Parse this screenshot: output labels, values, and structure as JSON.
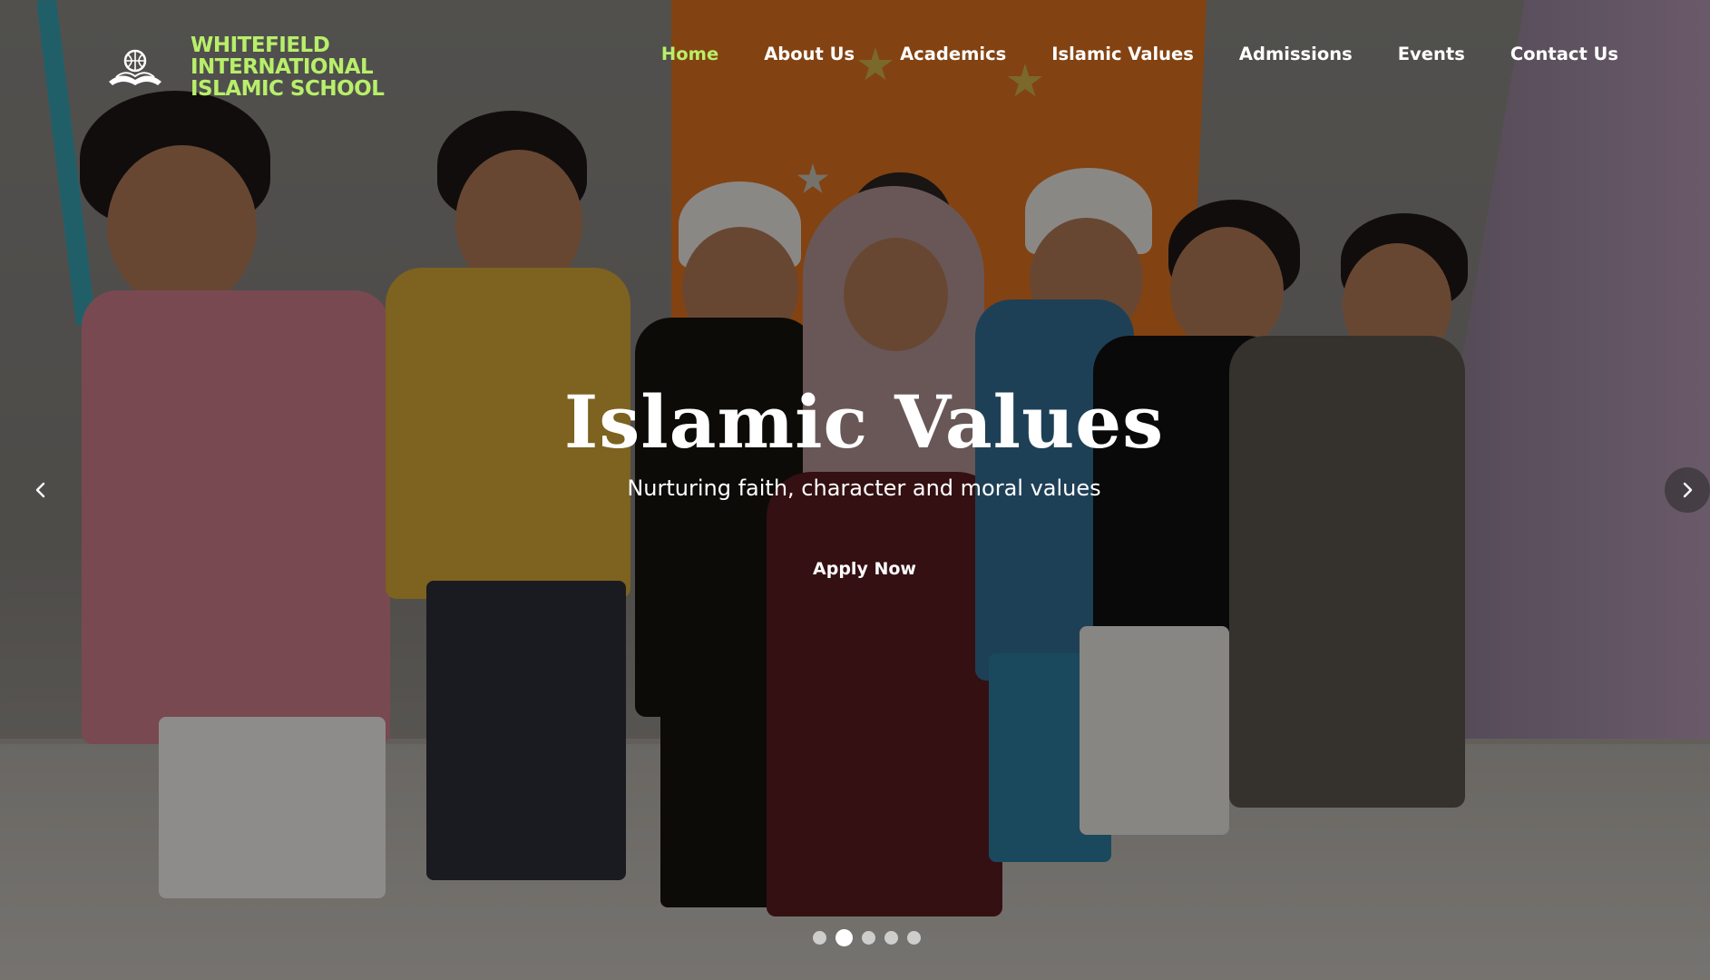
{
  "site": {
    "logo_lines": [
      "WHITEFIELD",
      "INTERNATIONAL",
      "ISLAMIC SCHOOL"
    ],
    "logo_icon": "globe-book-icon",
    "accent_color": "#b8ef6a"
  },
  "nav": {
    "items": [
      {
        "label": "Home",
        "active": true
      },
      {
        "label": "About Us",
        "active": false
      },
      {
        "label": "Academics",
        "active": false
      },
      {
        "label": "Islamic Values",
        "active": false
      },
      {
        "label": "Admissions",
        "active": false
      },
      {
        "label": "Events",
        "active": false
      },
      {
        "label": "Contact Us",
        "active": false
      }
    ]
  },
  "hero": {
    "title": "Islamic Values",
    "subtitle": "Nurturing faith, character and moral values",
    "cta_label": "Apply Now"
  },
  "carousel": {
    "prev_icon": "chevron-left-icon",
    "next_icon": "chevron-right-icon",
    "slide_count": 5,
    "active_slide": 2
  }
}
